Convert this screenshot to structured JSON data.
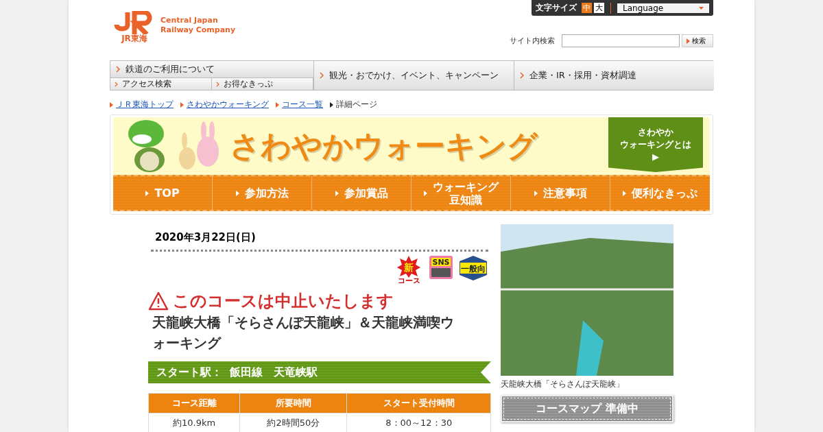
{
  "header": {
    "logo_mark": "JR東海",
    "company": [
      "Central Japan",
      "Railway Company"
    ],
    "font_size": {
      "label": "文字サイズ",
      "options": [
        {
          "label": "中",
          "selected": true
        },
        {
          "label": "大",
          "selected": false
        }
      ]
    },
    "language": "Language",
    "search": {
      "label": "サイト内検索",
      "button": "検索"
    }
  },
  "main_nav": [
    {
      "label": "鉄道のご利用について",
      "children": [
        {
          "label": "アクセス検索"
        },
        {
          "label": "お得なきっぷ"
        }
      ]
    },
    {
      "label": "観光・おでかけ、イベント、キャンペーン"
    },
    {
      "label": "企業・IR・採用・資材調達"
    }
  ],
  "breadcrumb": [
    {
      "label": "ＪＲ東海トップ",
      "link": true
    },
    {
      "label": "さわやかウォーキング",
      "link": true
    },
    {
      "label": "コース一覧",
      "link": true
    },
    {
      "label": "詳細ページ",
      "link": false
    }
  ],
  "banner": {
    "title": "さわやかウォーキング",
    "about": [
      "さわやか",
      "ウォーキングとは"
    ],
    "about_arrow": "▶"
  },
  "section_nav": [
    [
      "TOP"
    ],
    [
      "参加方法"
    ],
    [
      "参加賞品"
    ],
    [
      "ウォーキング",
      "豆知識"
    ],
    [
      "注意事項"
    ],
    [
      "便利なきっぷ"
    ]
  ],
  "course": {
    "date": "2020年3月22日(日)",
    "badges": [
      {
        "kind": "new",
        "label": "新",
        "sub": "コース"
      },
      {
        "kind": "sns",
        "label": "SNS"
      },
      {
        "kind": "general",
        "label": "一般向"
      }
    ],
    "notice": "このコースは中止いたします",
    "title": "天龍峡大橋「そらさんぽ天龍峡」＆天龍峡満喫ウォーキング",
    "start_station": "スタート駅：  飯田線　天竜峡駅",
    "table": {
      "columns": [
        "コース距離",
        "所要時間",
        "スタート受付時間"
      ],
      "rows": [
        [
          "約10.9km",
          "約2時間50分",
          "8：00～12：30"
        ]
      ]
    },
    "photo_caption": "天龍峡大橋「そらさんぽ天龍峡」",
    "map_button": {
      "label": "コースマップ 準備中",
      "disabled": true
    }
  }
}
